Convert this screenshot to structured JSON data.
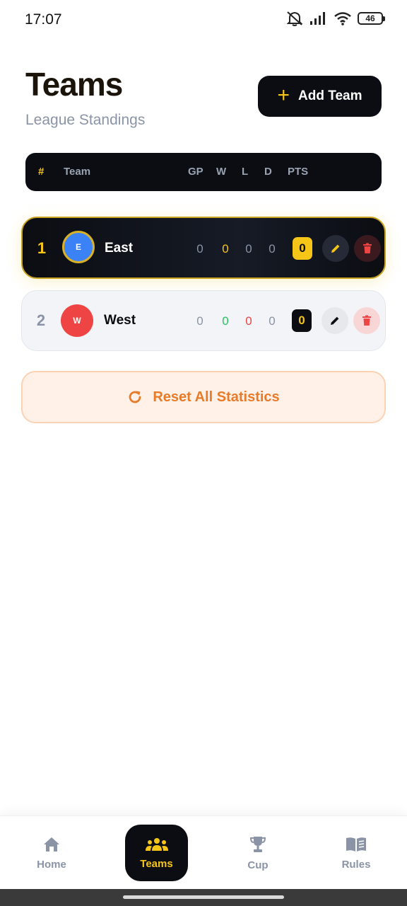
{
  "status_bar": {
    "time": "17:07",
    "battery": "46",
    "icons": [
      "mute-icon",
      "signal-icon",
      "wifi-icon",
      "battery-icon"
    ]
  },
  "header": {
    "title": "Teams",
    "subtitle": "League Standings",
    "add_button_label": "Add Team"
  },
  "table": {
    "columns": [
      "#",
      "Team",
      "GP",
      "W",
      "L",
      "D",
      "PTS"
    ],
    "rows": [
      {
        "rank": "1",
        "initial": "E",
        "name": "East",
        "gp": "0",
        "w": "0",
        "l": "0",
        "d": "0",
        "pts": "0",
        "avatar_color": "#3b82f6"
      },
      {
        "rank": "2",
        "initial": "W",
        "name": "West",
        "gp": "0",
        "w": "0",
        "l": "0",
        "d": "0",
        "pts": "0",
        "avatar_color": "#ef4444"
      }
    ]
  },
  "reset_button_label": "Reset All Statistics",
  "nav": {
    "items": [
      {
        "label": "Home",
        "icon": "home-icon"
      },
      {
        "label": "Teams",
        "icon": "teams-icon",
        "active": true
      },
      {
        "label": "Cup",
        "icon": "trophy-icon"
      },
      {
        "label": "Rules",
        "icon": "book-icon"
      }
    ]
  },
  "colors": {
    "accent": "#f5c518",
    "dark": "#0b0d12",
    "win": "#22c55e",
    "loss": "#ef4444",
    "reset": "#e87b2a"
  }
}
